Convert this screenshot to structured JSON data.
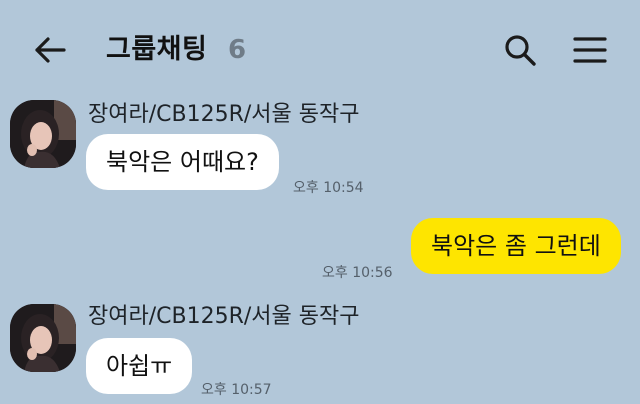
{
  "header": {
    "title": "그룹채팅",
    "member_count": "6"
  },
  "messages": [
    {
      "direction": "incoming",
      "sender": "장여라/CB125R/서울 동작구",
      "text": "북악은 어때요?",
      "time": "오후 10:54"
    },
    {
      "direction": "outgoing",
      "text": "북악은 좀 그런데",
      "time": "오후 10:56"
    },
    {
      "direction": "incoming",
      "sender": "장여라/CB125R/서울 동작구",
      "text": "아쉽ㅠ",
      "time": "오후 10:57"
    }
  ],
  "colors": {
    "background": "#b2c7d9",
    "outgoing_bubble": "#fee500",
    "incoming_bubble": "#ffffff"
  }
}
